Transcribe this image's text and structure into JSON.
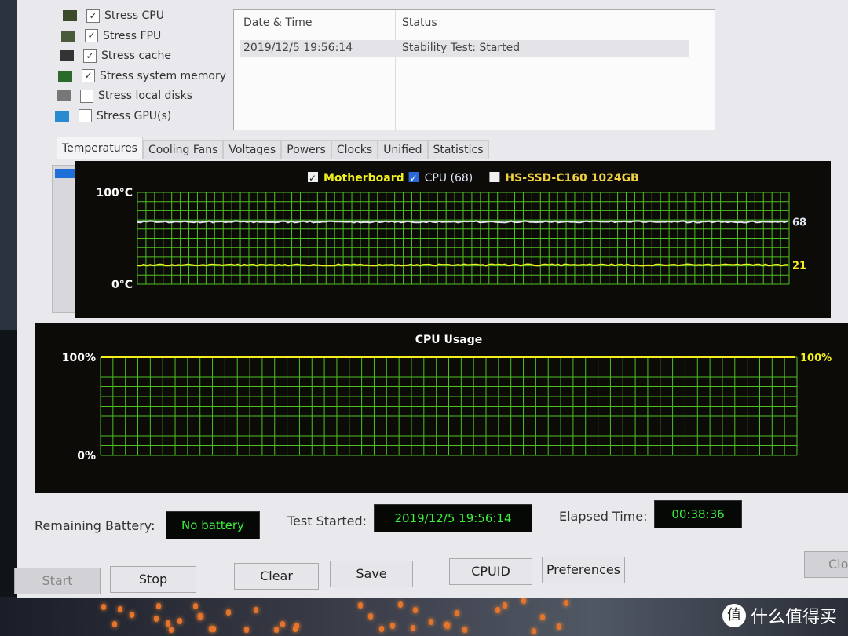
{
  "stress_options": [
    {
      "label": "Stress CPU",
      "checked": true,
      "icon": "cpu-chip-icon"
    },
    {
      "label": "Stress FPU",
      "checked": true,
      "icon": "fpu-icon"
    },
    {
      "label": "Stress cache",
      "checked": true,
      "icon": "cache-chip-icon"
    },
    {
      "label": "Stress system memory",
      "checked": true,
      "icon": "memory-module-icon"
    },
    {
      "label": "Stress local disks",
      "checked": false,
      "icon": "disk-drive-icon"
    },
    {
      "label": "Stress GPU(s)",
      "checked": false,
      "icon": "monitor-icon"
    }
  ],
  "log": {
    "headers": [
      "Date & Time",
      "Status"
    ],
    "rows": [
      {
        "datetime": "2019/12/5 19:56:14",
        "status": "Stability Test: Started"
      }
    ]
  },
  "tabs": [
    "Temperatures",
    "Cooling Fans",
    "Voltages",
    "Powers",
    "Clocks",
    "Unified",
    "Statistics"
  ],
  "active_tab": "Temperatures",
  "chart_data": [
    {
      "type": "line",
      "title": "",
      "legend": [
        {
          "name": "Motherboard",
          "checked": true,
          "color": "#f0f020"
        },
        {
          "name": "CPU (68)",
          "checked": true,
          "color": "#e0e8f8"
        },
        {
          "name": "HS-SSD-C160 1024GB",
          "checked": false,
          "color": "#f0d040"
        }
      ],
      "ylim": [
        0,
        100
      ],
      "y_top_label": "100°C",
      "y_bottom_label": "0°C",
      "series": [
        {
          "name": "CPU",
          "value": 68,
          "end_label": "68",
          "color": "#dfe6f0"
        },
        {
          "name": "Motherboard",
          "value": 21,
          "end_label": "21",
          "color": "#f4f020"
        }
      ],
      "grid": true,
      "grid_color": "#4ec020"
    },
    {
      "type": "line",
      "title": "CPU Usage",
      "ylim": [
        0,
        100
      ],
      "y_top_label": "100%",
      "y_bottom_label": "0%",
      "series": [
        {
          "name": "CPU Usage",
          "value": 100,
          "end_label": "100%",
          "color": "#f4f020"
        }
      ],
      "grid": true,
      "grid_color": "#4ec020"
    }
  ],
  "status": {
    "battery_label": "Remaining Battery:",
    "battery_value": "No battery",
    "started_label": "Test Started:",
    "started_value": "2019/12/5 19:56:14",
    "elapsed_label": "Elapsed Time:",
    "elapsed_value": "00:38:36"
  },
  "buttons": {
    "start": "Start",
    "stop": "Stop",
    "clear": "Clear",
    "save": "Save",
    "cpuid": "CPUID",
    "preferences": "Preferences",
    "close": "Clo"
  },
  "watermark": {
    "logo": "值",
    "text": "什么值得买"
  }
}
